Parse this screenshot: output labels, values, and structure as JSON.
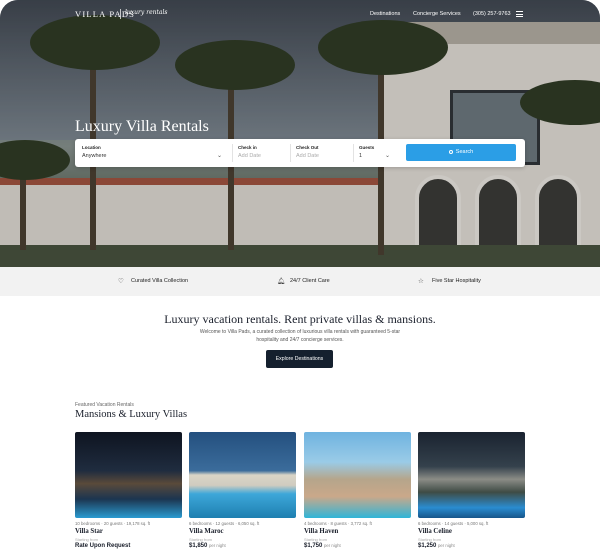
{
  "nav": {
    "logo": "VILLA PADS",
    "logo_script": "luxury rentals",
    "links": [
      "Destinations",
      "Concierge Services",
      "(305) 257-9763"
    ]
  },
  "hero": {
    "title": "Luxury Villa Rentals"
  },
  "search": {
    "location_label": "Location",
    "location_value": "Anywhere",
    "checkin_label": "Check in",
    "checkin_placeholder": "Add Date",
    "checkout_label": "Check Out",
    "checkout_placeholder": "Add Date",
    "guests_label": "Guests",
    "guests_value": "1",
    "button_label": "Search"
  },
  "features": [
    "Curated Villa Collection",
    "24/7 Client Care",
    "Five Star Hospitality"
  ],
  "intro": {
    "title": "Luxury vacation rentals. Rent private villas & mansions.",
    "text": "Welcome to Villa Pads, a curated collection of luxurious villa rentals with guaranteed 5-star hospitality and 24/7 concierge services.",
    "button": "Explore Destinations"
  },
  "featured": {
    "kicker": "Featured Vacation Rentals",
    "title": "Mansions & Luxury Villas",
    "cards": [
      {
        "meta": "10 bedrooms · 20 guests · 19,178 sq. ft",
        "name": "Villa Star",
        "sub": "Starting from",
        "price": "Rate Upon Request",
        "unit": ""
      },
      {
        "meta": "6 bedrooms · 12 guests · 6,050 sq. ft",
        "name": "Villa Maroc",
        "sub": "Starting from",
        "price": "$1,850",
        "unit": "per night"
      },
      {
        "meta": "4 bedrooms · 8 guests · 3,772 sq. ft",
        "name": "Villa Haven",
        "sub": "Starting from",
        "price": "$1,750",
        "unit": "per night"
      },
      {
        "meta": "6 bedrooms · 14 guests · 5,000 sq. ft",
        "name": "Villa Celine",
        "sub": "Starting from",
        "price": "$1,250",
        "unit": "per night"
      }
    ]
  },
  "colors": {
    "accent": "#2b9ee6",
    "dark": "#15202e",
    "features_bg": "#f2f2f2"
  }
}
